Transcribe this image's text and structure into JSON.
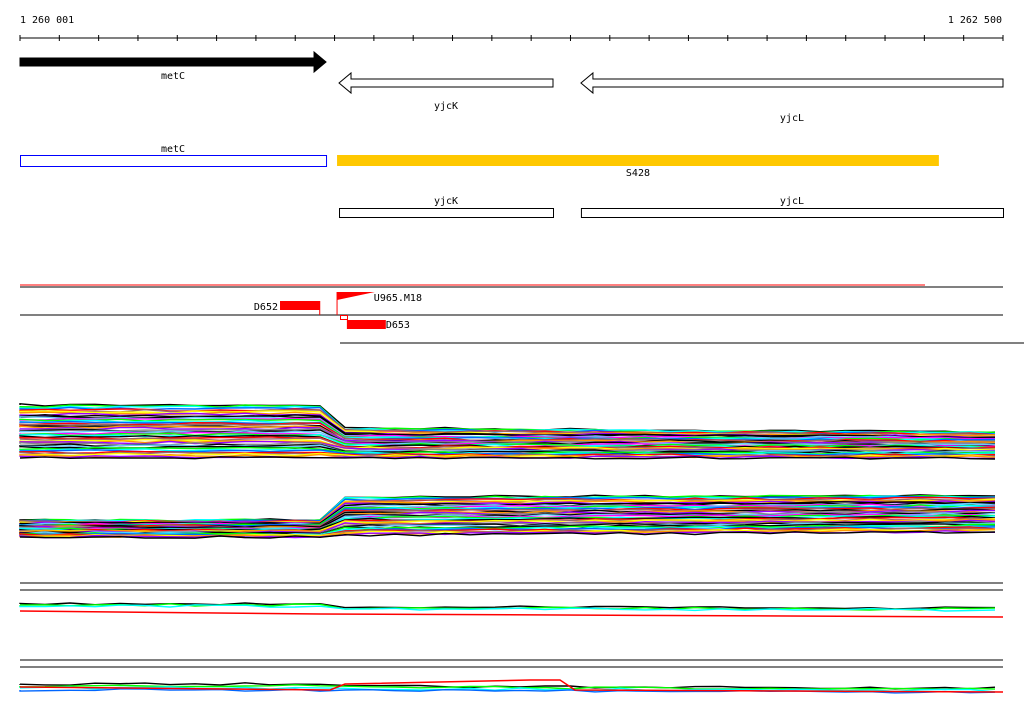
{
  "ruler": {
    "start_label": "1 260 001",
    "end_label": "1 262 500",
    "start": 1260001,
    "end": 1262500,
    "tick_count": 25
  },
  "genes": [
    {
      "name": "metC",
      "start": 1260001,
      "end": 1260779,
      "strand": "+",
      "style": "filled"
    },
    {
      "name": "yjcK",
      "start": 1260812,
      "end": 1261356,
      "strand": "-",
      "style": "outline"
    },
    {
      "name": "yjcL",
      "start": 1261427,
      "end": 1262500,
      "strand": "-",
      "style": "outline"
    }
  ],
  "cds_boxes": [
    {
      "name": "metC",
      "start": 1260001,
      "end": 1260779,
      "color": "#0000ff"
    },
    {
      "name": "yjcK",
      "start": 1260812,
      "end": 1261356,
      "color": "#000000"
    },
    {
      "name": "yjcL",
      "start": 1261427,
      "end": 1262500,
      "color": "#000000"
    }
  ],
  "transcript": {
    "name": "S428",
    "start": 1260807,
    "end": 1262337,
    "color": "#ffc800"
  },
  "elements": [
    {
      "name": "D652",
      "start": 1260662,
      "end": 1260763,
      "color": "#ff0000"
    },
    {
      "name": "U965.M18",
      "start": 1260807,
      "end": 1260903,
      "color": "#ff0000"
    },
    {
      "name": "D653",
      "start": 1260832,
      "end": 1260931,
      "color": "#ff0000"
    }
  ],
  "colors": {
    "palette": [
      "#ff00ff",
      "#00ff00",
      "#00ffff",
      "#0066ff",
      "#ff0000",
      "#996666",
      "#ffff00",
      "#ff9900",
      "#9900ff",
      "#888888",
      "#000000",
      "#66ccff"
    ]
  }
}
